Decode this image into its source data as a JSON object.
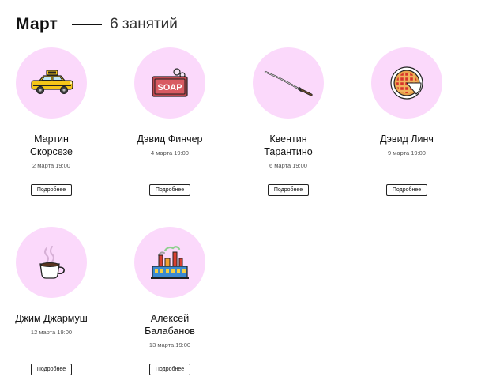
{
  "header": {
    "month": "Март",
    "count": "6 занятий"
  },
  "cards": [
    {
      "name": "Мартин Скорсезе",
      "date": "2 марта 19:00",
      "button": "Подробнее",
      "icon": "taxi-icon"
    },
    {
      "name": "Дэвид Финчер",
      "date": "4 марта 19:00",
      "button": "Подробнее",
      "icon": "soap-icon"
    },
    {
      "name": "Квентин Тарантино",
      "date": "6 марта 19:00",
      "button": "Подробнее",
      "icon": "katana-icon"
    },
    {
      "name": "Дэвид Линч",
      "date": "9 марта 19:00",
      "button": "Подробнее",
      "icon": "cherry-pie-icon"
    },
    {
      "name": "Джим Джармуш",
      "date": "12 марта 19:00",
      "button": "Подробнее",
      "icon": "coffee-cup-icon"
    },
    {
      "name": "Алексей Балабанов",
      "date": "13 марта 19:00",
      "button": "Подробнее",
      "icon": "factory-icon"
    }
  ],
  "colors": {
    "circle": "#fbd9fb",
    "text": "#111111"
  }
}
